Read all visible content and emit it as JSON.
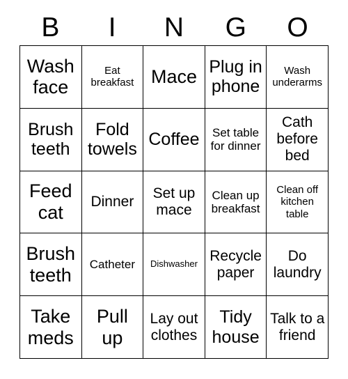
{
  "card": {
    "title": "BINGO",
    "header_letters": [
      "B",
      "I",
      "N",
      "G",
      "O"
    ],
    "grid_size": "5x5",
    "border_color": "#000000",
    "background_color": "#ffffff",
    "text_color": "#000000"
  },
  "rows": [
    {
      "cells": [
        {
          "text": "Wash face",
          "size": "xl"
        },
        {
          "text": "Eat breakfast",
          "size": "xs"
        },
        {
          "text": "Mace",
          "size": "xl"
        },
        {
          "text": "Plug in phone",
          "size": "lg"
        },
        {
          "text": "Wash underarms",
          "size": "xs"
        }
      ]
    },
    {
      "cells": [
        {
          "text": "Brush teeth",
          "size": "lg"
        },
        {
          "text": "Fold towels",
          "size": "lg"
        },
        {
          "text": "Coffee",
          "size": "lg"
        },
        {
          "text": "Set table for dinner",
          "size": "sm"
        },
        {
          "text": "Cath before bed",
          "size": "md"
        }
      ]
    },
    {
      "cells": [
        {
          "text": "Feed cat",
          "size": "xl"
        },
        {
          "text": "Dinner",
          "size": "md"
        },
        {
          "text": "Set up mace",
          "size": "md"
        },
        {
          "text": "Clean up breakfast",
          "size": "sm"
        },
        {
          "text": "Clean off kitchen table",
          "size": "xs"
        }
      ]
    },
    {
      "cells": [
        {
          "text": "Brush teeth",
          "size": "xl"
        },
        {
          "text": "Catheter",
          "size": "sm"
        },
        {
          "text": "Dishwasher",
          "size": "xxs"
        },
        {
          "text": "Recycle paper",
          "size": "md"
        },
        {
          "text": "Do laundry",
          "size": "md"
        }
      ]
    },
    {
      "cells": [
        {
          "text": "Take meds",
          "size": "xl"
        },
        {
          "text": "Pull up",
          "size": "xl"
        },
        {
          "text": "Lay out clothes",
          "size": "md"
        },
        {
          "text": "Tidy house",
          "size": "lg"
        },
        {
          "text": "Talk to a friend",
          "size": "md"
        }
      ]
    }
  ]
}
